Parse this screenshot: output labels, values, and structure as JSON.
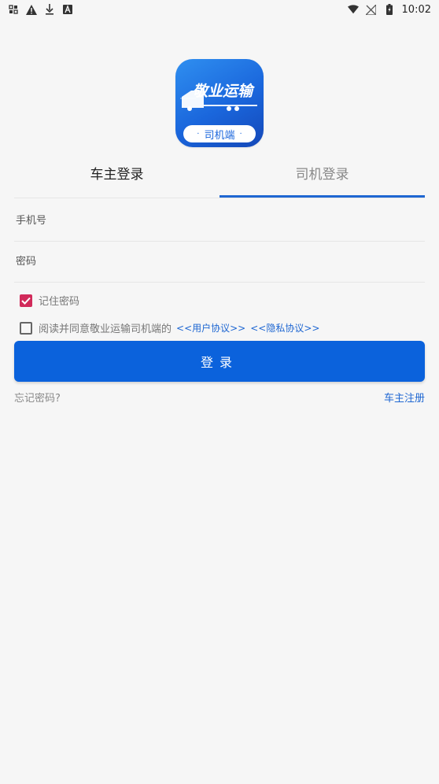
{
  "status_bar": {
    "left_icons": [
      "sim-icon",
      "warning-icon",
      "download-icon",
      "a-icon"
    ],
    "right_icons": [
      "wifi-icon",
      "no-signal-icon",
      "battery-icon"
    ],
    "time": "10:02"
  },
  "logo": {
    "title": "敬业运输",
    "subtitle": "司机端",
    "dot": "·",
    "colors": {
      "gradient_start": "#2f8ff0",
      "gradient_end": "#1448b8"
    }
  },
  "tabs": {
    "owner_label": "车主登录",
    "driver_label": "司机登录",
    "active": "driver"
  },
  "form": {
    "phone_placeholder": "手机号",
    "password_placeholder": "密码",
    "remember_label": "记住密码",
    "remember_checked": true,
    "agree_text": "阅读并同意敬业运输司机端的",
    "agree_checked": false,
    "user_agreement": "<<用户协议>>",
    "privacy_agreement": "<<隐私协议>>",
    "login_label": "登录"
  },
  "footer": {
    "forgot_label": "忘记密码?",
    "register_label": "车主注册"
  },
  "colors": {
    "accent": "#1f67d2",
    "button": "#0b62dc",
    "checkbox": "#d12a5a"
  }
}
